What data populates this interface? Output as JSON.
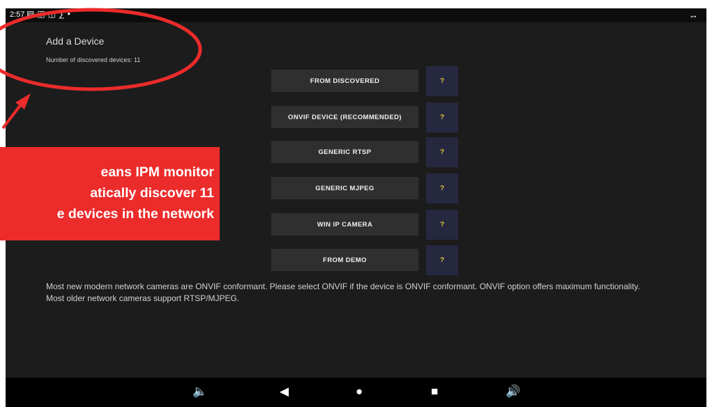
{
  "status_bar": {
    "time": "2:57",
    "icons": [
      "notification-icon",
      "screen-icon",
      "cast-icon",
      "s-app-icon",
      "dot-icon"
    ],
    "right_icon": "expand-arrows-icon"
  },
  "header": {
    "title": "Add a Device",
    "subtitle": "Number of discovered devices: 11"
  },
  "options": [
    {
      "label": "FROM DISCOVERED",
      "help": "?"
    },
    {
      "label": "ONVIF DEVICE (RECOMMENDED)",
      "help": "?"
    },
    {
      "label": "GENERIC RTSP",
      "help": "?"
    },
    {
      "label": "GENERIC MJPEG",
      "help": "?"
    },
    {
      "label": "WIN IP CAMERA",
      "help": "?"
    },
    {
      "label": "FROM DEMO",
      "help": "?"
    }
  ],
  "info": {
    "line1": "Most new modern network cameras are ONVIF conformant. Please select ONVIF if the device is ONVIF conformant. ONVIF option offers maximum functionality.",
    "line2": "Most older network cameras support RTSP/MJPEG."
  },
  "nav_bar": {
    "icons": [
      "volume-down-icon",
      "back-icon",
      "home-icon",
      "recents-icon",
      "volume-up-icon"
    ]
  },
  "annotation": {
    "text": "eans IPM monitor\natically discover 11\ne devices in the network",
    "color": "#ec2b2b"
  },
  "colors": {
    "background": "#1c1c1c",
    "button": "#2f2f2f",
    "help_button": "#262840",
    "help_text": "#e3c634",
    "annotation": "#ec2b2b"
  }
}
